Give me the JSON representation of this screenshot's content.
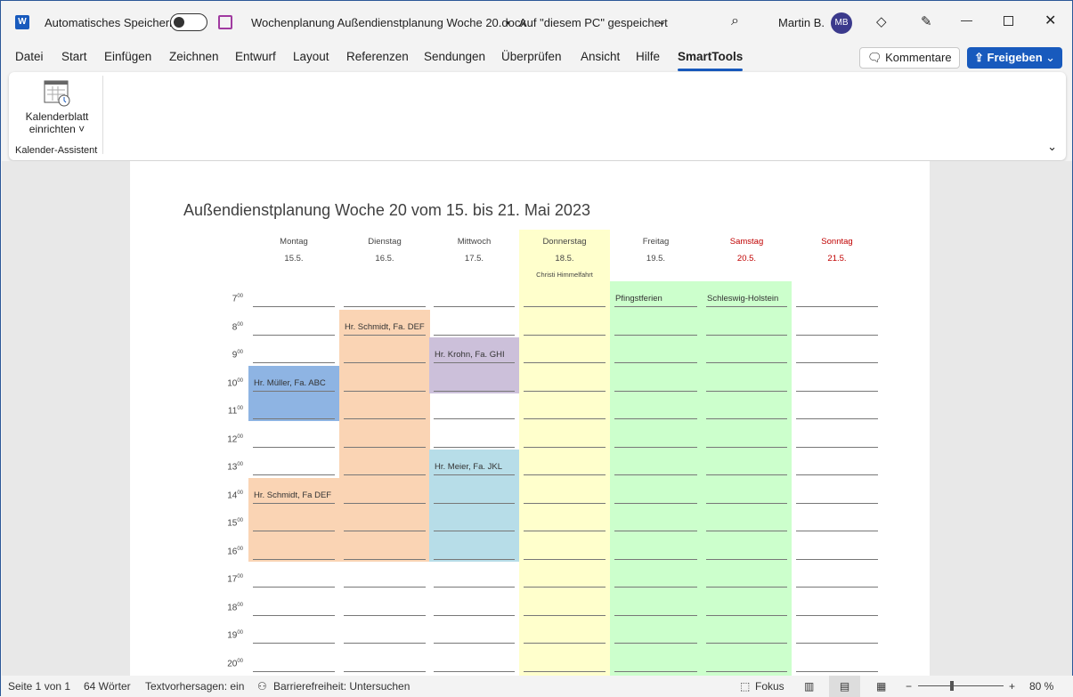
{
  "titlebar": {
    "autosave_label": "Automatisches Speichern",
    "doc_title": "Wochenplanung Außendienstplanung Woche 20.docx",
    "save_location": "Auf \"diesem PC\" gespeichert",
    "user_name": "Martin B.",
    "user_initials": "MB"
  },
  "tabs": [
    "Datei",
    "Start",
    "Einfügen",
    "Zeichnen",
    "Entwurf",
    "Layout",
    "Referenzen",
    "Sendungen",
    "Überprüfen",
    "Ansicht",
    "Hilfe",
    "SmartTools"
  ],
  "active_tab": "SmartTools",
  "buttons": {
    "comments": "Kommentare",
    "share": "Freigeben"
  },
  "ribbon": {
    "button_line1": "Kalenderblatt",
    "button_line2": "einrichten",
    "group_label": "Kalender-Assistent"
  },
  "document": {
    "title": "Außendienstplanung Woche 20 vom 15. bis 21. Mai 2023",
    "hours": [
      7,
      8,
      9,
      10,
      11,
      12,
      13,
      14,
      15,
      16,
      17,
      18,
      19,
      20
    ],
    "hour_suffix": "00",
    "days": [
      {
        "name": "Montag",
        "date": "15.5.",
        "note": "",
        "color": "#444444",
        "bg": "",
        "bg_from": null,
        "labels": []
      },
      {
        "name": "Dienstag",
        "date": "16.5.",
        "note": "",
        "color": "#444444",
        "bg": "",
        "bg_from": null,
        "labels": []
      },
      {
        "name": "Mittwoch",
        "date": "17.5.",
        "note": "",
        "color": "#444444",
        "bg": "",
        "bg_from": null,
        "labels": []
      },
      {
        "name": "Donnerstag",
        "date": "18.5.",
        "note": "Christi Himmelfahrt",
        "color": "#444444",
        "bg": "#ffffcc",
        "bg_from": "header",
        "labels": []
      },
      {
        "name": "Freitag",
        "date": "19.5.",
        "note": "",
        "color": "#444444",
        "bg": "#ccffcc",
        "bg_from": 7,
        "labels": [
          {
            "hour": 7,
            "text": "Pfingstferien"
          }
        ]
      },
      {
        "name": "Samstag",
        "date": "20.5.",
        "note": "",
        "color": "#c00000",
        "bg": "#ccffcc",
        "bg_from": 7,
        "labels": [
          {
            "hour": 7,
            "text": "Schleswig-Holstein"
          }
        ]
      },
      {
        "name": "Sonntag",
        "date": "21.5.",
        "note": "",
        "color": "#c00000",
        "bg": "",
        "bg_from": null,
        "labels": []
      }
    ],
    "events": [
      {
        "day": 0,
        "start": 10,
        "end": 11,
        "text": "Hr. Müller, Fa. ABC",
        "color": "#8eb4e3"
      },
      {
        "day": 0,
        "start": 14,
        "end": 16,
        "text": "Hr. Schmidt, Fa DEF",
        "color": "#fad4b4"
      },
      {
        "day": 1,
        "start": 8,
        "end": 16,
        "text": "Hr. Schmidt, Fa. DEF",
        "color": "#fad4b4"
      },
      {
        "day": 2,
        "start": 9,
        "end": 10,
        "text": "Hr. Krohn, Fa. GHI",
        "color": "#ccc0da"
      },
      {
        "day": 2,
        "start": 13,
        "end": 16,
        "text": "Hr. Meier, Fa. JKL",
        "color": "#b7dde8"
      }
    ]
  },
  "status": {
    "page": "Seite 1 von 1",
    "words": "64 Wörter",
    "predictions": "Textvorhersagen: ein",
    "accessibility": "Barrierefreiheit: Untersuchen",
    "focus": "Fokus",
    "zoom": "80 %",
    "zoom_percent": 80
  }
}
